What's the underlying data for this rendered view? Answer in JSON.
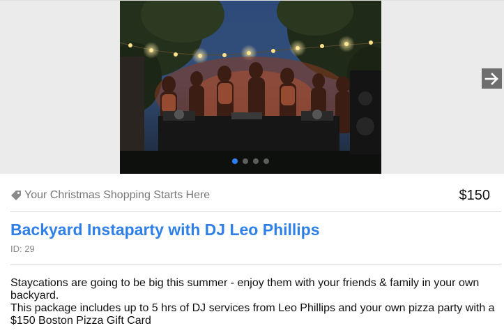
{
  "carousel": {
    "image_alt": "Backyard party with DJ under string lights",
    "slide_count": 4,
    "active_slide": 1,
    "next_icon": "arrow-right-icon",
    "dot_active_color": "#2e7cf6"
  },
  "promo": {
    "icon": "tag-icon",
    "text": "Your Christmas Shopping Starts Here",
    "price": "$150"
  },
  "product": {
    "title": "Backyard Instaparty with DJ Leo Phillips",
    "id": "ID: 29",
    "title_color": "#2f7fe8"
  },
  "description": {
    "line1": "Staycations are going to be big this summer - enjoy them with your friends & family in your own backyard.",
    "line2": "This package includes up to 5 hrs of DJ services from Leo Phillips and your own pizza party with a $150 Boston Pizza Gift Card"
  }
}
